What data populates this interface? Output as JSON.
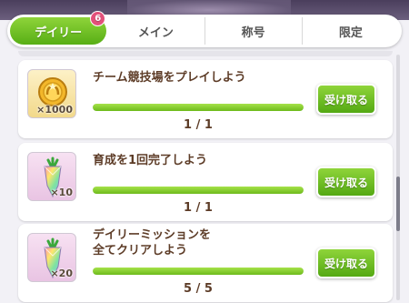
{
  "tabs": [
    {
      "label": "デイリー",
      "badge": "6"
    },
    {
      "label": "メイン"
    },
    {
      "label": "称号"
    },
    {
      "label": "限定"
    }
  ],
  "missions": [
    {
      "title": "チーム競技場をプレイしよう",
      "quantity": "×1000",
      "progress_text": "1 / 1",
      "progress": 1.0,
      "claim_label": "受け取る",
      "reward_icon": "coin-icon"
    },
    {
      "title": "育成を1回完了しよう",
      "quantity": "×10",
      "progress_text": "1 / 1",
      "progress": 1.0,
      "claim_label": "受け取る",
      "reward_icon": "carrot-crystal-icon"
    },
    {
      "title": "デイリーミッションを\n全てクリアしよう",
      "quantity": "×20",
      "progress_text": "5 / 5",
      "progress": 1.0,
      "claim_label": "受け取る",
      "reward_icon": "carrot-crystal-icon"
    }
  ],
  "colors": {
    "accent_green": "#6dbb1c",
    "badge_pink": "#e3507a",
    "title_brown": "#5d3c27"
  }
}
